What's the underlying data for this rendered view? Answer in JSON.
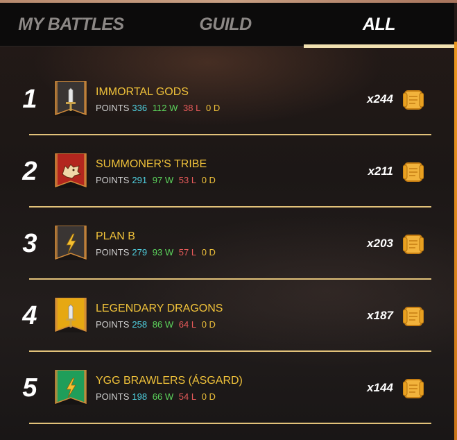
{
  "tabs": [
    {
      "label": "MY BATTLES",
      "active": false
    },
    {
      "label": "GUILD",
      "active": false
    },
    {
      "label": "ALL",
      "active": true
    }
  ],
  "stat_labels": {
    "points": "POINTS",
    "wins_suffix": "W",
    "losses_suffix": "L",
    "draws_suffix": "D"
  },
  "colors": {
    "name": "#f0c23a",
    "points": "#4fd0e0",
    "wins": "#5cd45c",
    "losses": "#e85a5a",
    "draws": "#f0c23a",
    "tab_underline": "#f0e0b0",
    "accent": "#e9961f"
  },
  "guilds": [
    {
      "rank": "1",
      "name": "IMMORTAL GODS",
      "points": "336",
      "wins": "112",
      "losses": "38",
      "draws": "0",
      "reward": "x244",
      "badge_color": "#3a3533",
      "badge_icon": "sword-icon"
    },
    {
      "rank": "2",
      "name": "SUMMONER'S TRIBE",
      "points": "291",
      "wins": "97",
      "losses": "53",
      "draws": "0",
      "reward": "x211",
      "badge_color": "#b3261e",
      "badge_icon": "wolf-icon"
    },
    {
      "rank": "3",
      "name": "PLAN B",
      "points": "279",
      "wins": "93",
      "losses": "57",
      "draws": "0",
      "reward": "x203",
      "badge_color": "#3a3533",
      "badge_icon": "lightning-icon"
    },
    {
      "rank": "4",
      "name": "LEGENDARY DRAGONS",
      "points": "258",
      "wins": "86",
      "losses": "64",
      "draws": "0",
      "reward": "x187",
      "badge_color": "#e6a812",
      "badge_icon": "sword-icon"
    },
    {
      "rank": "5",
      "name": "YGG BRAWLERS (ÁSGARD)",
      "points": "198",
      "wins": "66",
      "losses": "54",
      "draws": "0",
      "reward": "x144",
      "badge_color": "#1f9e5a",
      "badge_icon": "lightning-icon"
    }
  ]
}
